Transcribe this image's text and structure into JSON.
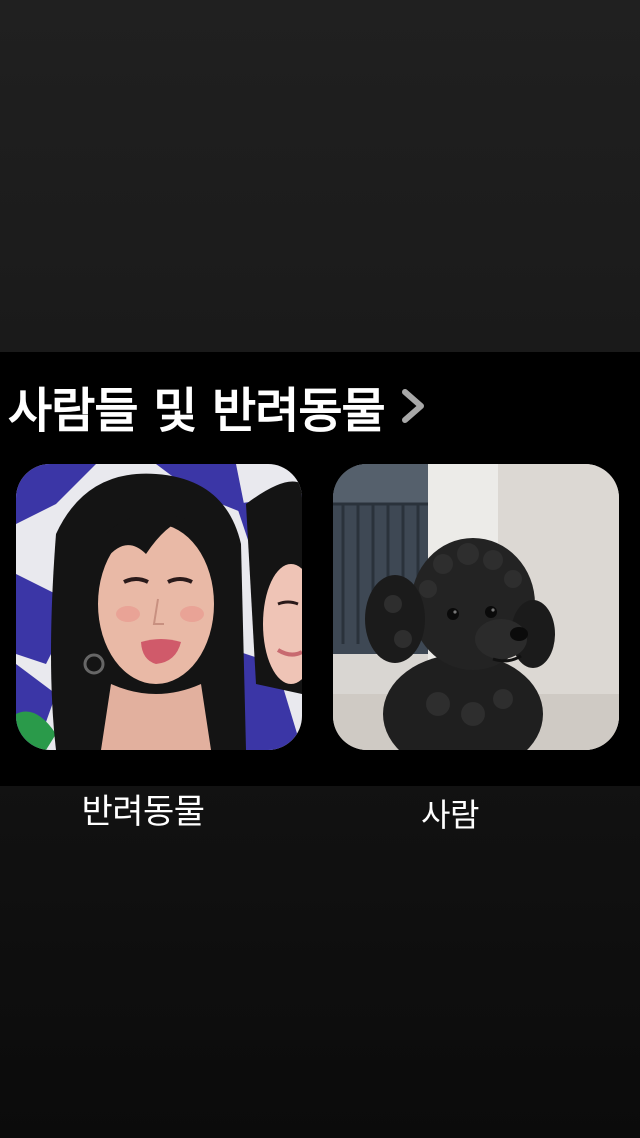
{
  "section": {
    "title": "사람들 및 반려동물",
    "chevron_icon": "chevron-right-icon"
  },
  "cards": [
    {
      "label": "반려동물",
      "image": "photo-of-two-people"
    },
    {
      "label": "사람",
      "image": "photo-of-black-poodle"
    }
  ],
  "colors": {
    "background": "#1a1a1a",
    "panel": "#000000",
    "text": "#ffffff",
    "chevron": "#a8a8a8"
  }
}
